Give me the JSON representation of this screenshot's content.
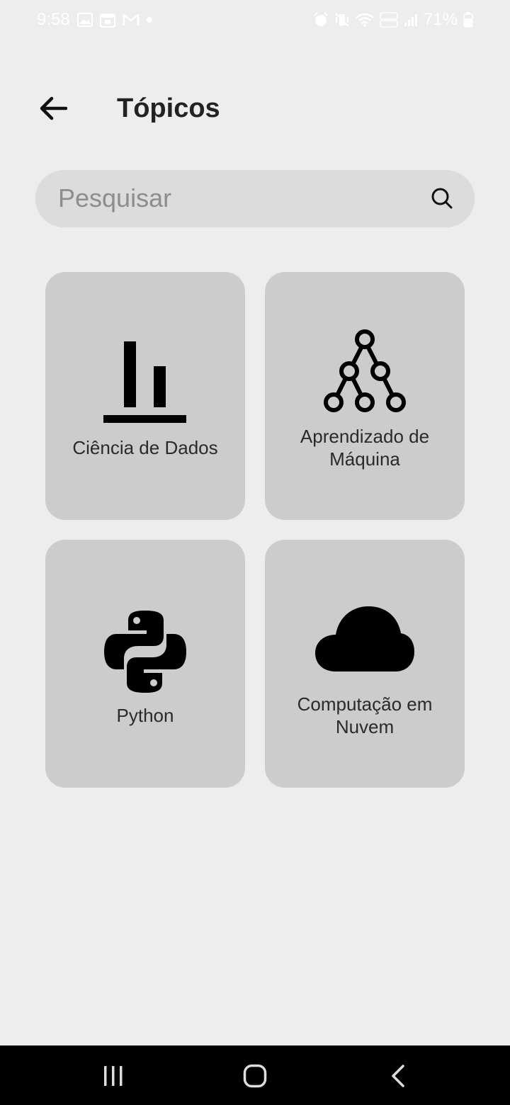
{
  "status_bar": {
    "time": "9:58",
    "battery": "71%"
  },
  "header": {
    "title": "Tópicos"
  },
  "search": {
    "placeholder": "Pesquisar"
  },
  "topics": [
    {
      "label": "Ciência de Dados",
      "icon": "bar-chart-icon"
    },
    {
      "label": "Aprendizado de Máquina",
      "icon": "tree-network-icon"
    },
    {
      "label": "Python",
      "icon": "python-logo-icon"
    },
    {
      "label": "Computação em Nuvem",
      "icon": "cloud-icon"
    }
  ],
  "colors": {
    "background": "#ededed",
    "search_bg": "#dcdcdc",
    "card_bg": "#cccccc",
    "nav_bar": "#000000",
    "text": "#222222"
  }
}
